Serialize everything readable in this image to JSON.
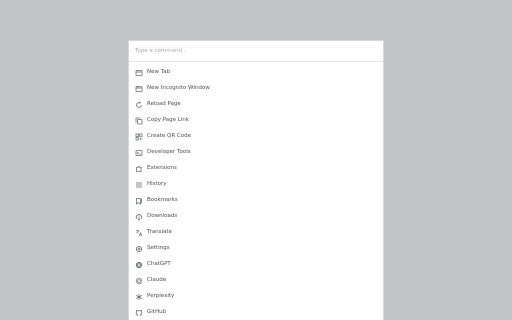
{
  "search": {
    "placeholder": "Type a command..."
  },
  "colors": {
    "backdrop": "#c3c5c8",
    "panel": "#ffffff",
    "text": "#4a4d52",
    "icon": "#6b6f75",
    "placeholder": "#a7a9ad"
  },
  "commands": [
    {
      "label": "New Tab",
      "icon": "new-tab-icon"
    },
    {
      "label": "New Incognito Window",
      "icon": "incognito-icon"
    },
    {
      "label": "Reload Page",
      "icon": "reload-icon"
    },
    {
      "label": "Copy Page Link",
      "icon": "copy-icon"
    },
    {
      "label": "Create QR Code",
      "icon": "qr-code-icon"
    },
    {
      "label": "Developer Tools",
      "icon": "terminal-icon"
    },
    {
      "label": "Extensions",
      "icon": "puzzle-icon"
    },
    {
      "label": "History",
      "icon": "list-icon"
    },
    {
      "label": "Bookmarks",
      "icon": "bookmark-icon"
    },
    {
      "label": "Downloads",
      "icon": "cloud-download-icon"
    },
    {
      "label": "Translate",
      "icon": "translate-icon"
    },
    {
      "label": "Settings",
      "icon": "gear-icon"
    },
    {
      "label": "ChatGPT",
      "icon": "chatgpt-icon"
    },
    {
      "label": "Claude",
      "icon": "claude-icon"
    },
    {
      "label": "Perplexity",
      "icon": "perplexity-icon"
    },
    {
      "label": "GitHub",
      "icon": "github-icon"
    }
  ]
}
